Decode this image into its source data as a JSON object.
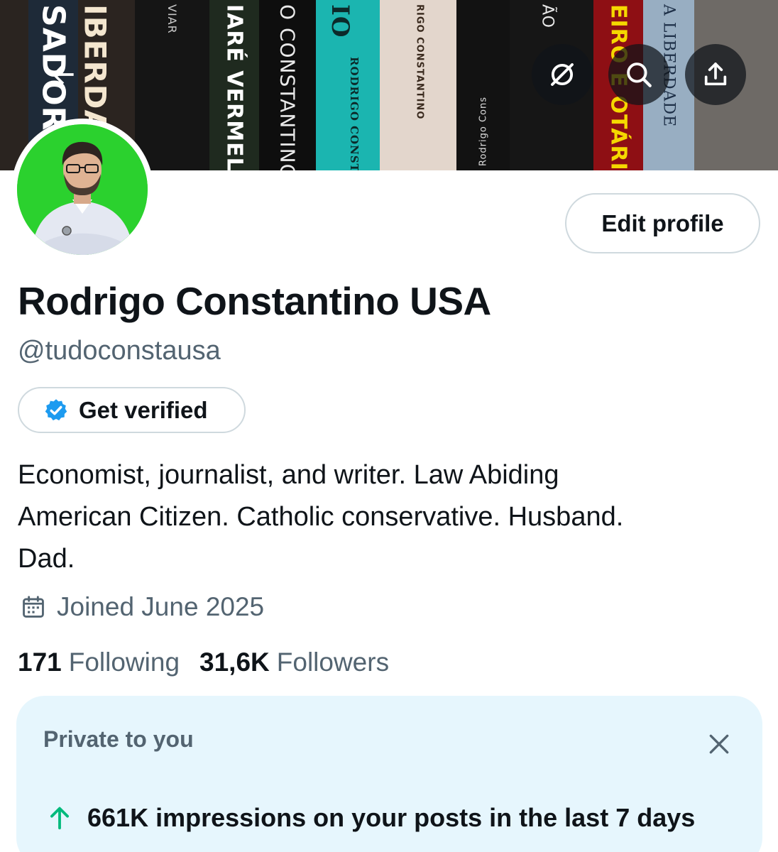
{
  "banner": {
    "spines": [
      {
        "text": "SADORE",
        "color": "#ffffff",
        "bg": "#1e2a38"
      },
      {
        "text": "IBERDAD",
        "color": "#f4e6cf",
        "bg": "#2b2420"
      },
      {
        "text": "VIAR",
        "color": "#c9c9c9",
        "bg": "#151515"
      },
      {
        "text": "IARÉ VERMELH",
        "color": "#ffffff",
        "bg": "#1f2a1f"
      },
      {
        "text": "O CONSTANTINO",
        "color": "#e9e9e9",
        "bg": "#0e0e0e"
      },
      {
        "text": "IO",
        "color": "#0c2a2a",
        "bg": "#1bb5b0"
      },
      {
        "text": "RODRIGO CONSTANTINO",
        "color": "#0c2a2a",
        "bg": "#1bb5b0"
      },
      {
        "text": "RIGO CONSTANTINO",
        "color": "#3a2a1e",
        "bg": "#e3d6cc"
      },
      {
        "text": "Rodrigo Cons",
        "color": "#dddddd",
        "bg": "#121212"
      },
      {
        "text": "ÃO",
        "color": "#e8e8e8",
        "bg": "#161616"
      },
      {
        "text": "EIRO E OTÁRIO",
        "color": "#f5d800",
        "bg": "#8e0f14"
      },
      {
        "text": "A LIBERDADE",
        "color": "#1d2f47",
        "bg": "#98aec2"
      }
    ]
  },
  "header": {
    "back_icon": "back-arrow-icon",
    "grok_icon": "grok-icon",
    "search_icon": "search-icon",
    "share_icon": "share-icon"
  },
  "profile": {
    "edit_label": "Edit profile",
    "name": "Rodrigo Constantino USA",
    "handle": "@tudoconstausa",
    "verify_label": "Get verified",
    "bio_lines": [
      "Economist, journalist, and writer. Law Abiding",
      "American Citizen. Catholic conservative. Husband.",
      "Dad."
    ],
    "joined": "Joined June 2025",
    "following_count": "171",
    "following_label": "Following",
    "followers_count": "31,6K",
    "followers_label": "Followers"
  },
  "private_card": {
    "title": "Private to you",
    "stat": "661K impressions on your posts in the last 7 days"
  },
  "colors": {
    "accent_blue": "#1d9bf0",
    "up_green": "#00ba7c",
    "muted": "#536471"
  }
}
